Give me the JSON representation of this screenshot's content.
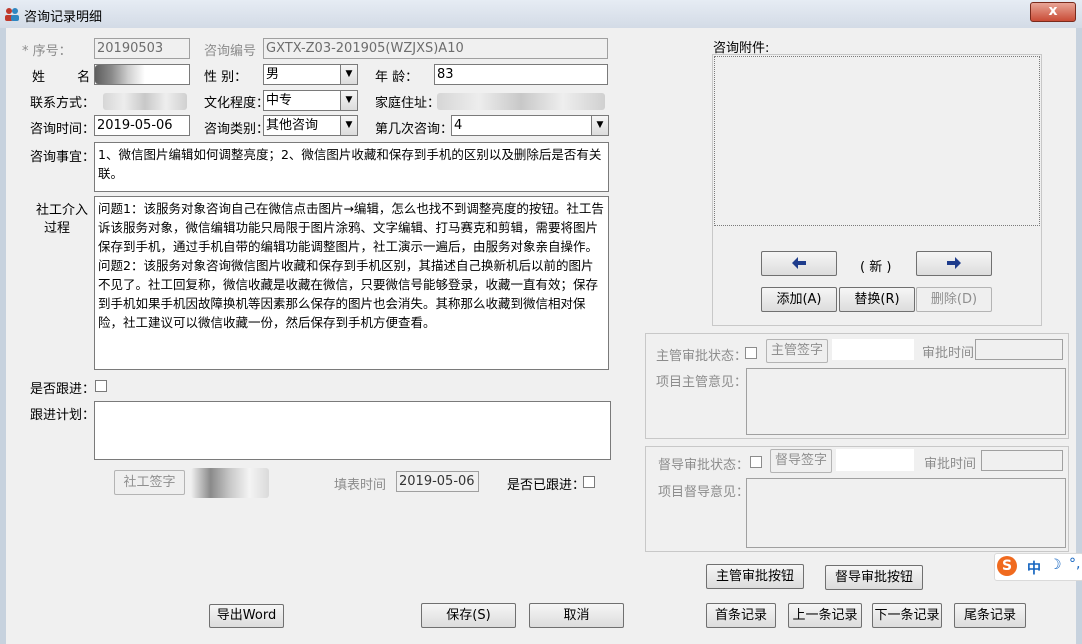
{
  "window": {
    "title": "咨询记录明细",
    "close_label": "x"
  },
  "fields": {
    "seq_label": "* 序号：",
    "seq_value": "20190503",
    "consult_no_label": "咨询编号",
    "consult_no_value": "GXTX-Z03-201905(WZJXS)A10",
    "name_label": "姓 名",
    "gender_label": "性 别：",
    "gender_value": "男",
    "age_label": "年 龄：",
    "age_value": "83",
    "contact_label": "联系方式：",
    "education_label": "文化程度：",
    "education_value": "中专",
    "address_label": "家庭住址：",
    "consult_time_label": "咨询时间：",
    "consult_time_value": "2019-05-06",
    "consult_type_label": "咨询类别：",
    "consult_type_value": "其他咨询",
    "nth_label": "第几次咨询：",
    "nth_value": "4",
    "matter_label": "咨询事宜：",
    "matter_value": "1、微信图片编辑如何调整亮度；2、微信图片收藏和保存到手机的区别以及删除后是否有关联。",
    "process_label_1": "社工介入",
    "process_label_2": "过程",
    "process_value": "问题1：该服务对象咨询自己在微信点击图片→编辑，怎么也找不到调整亮度的按钮。社工告诉该服务对象，微信编辑功能只局限于图片涂鸦、文字编辑、打马赛克和剪辑，需要将图片保存到手机，通过手机自带的编辑功能调整图片，社工演示一遍后，由服务对象亲自操作。\n问题2：该服务对象咨询微信图片收藏和保存到手机区别，其描述自己换新机后以前的图片不见了。社工回复称，微信收藏是收藏在微信，只要微信号能够登录，收藏一直有效；保存到手机如果手机因故障换机等因素那么保存的图片也会消失。其称那么收藏到微信相对保险，社工建议可以微信收藏一份，然后保存到手机方便查看。",
    "followup_label": "是否跟进：",
    "plan_label": "跟进计划：",
    "worker_sign_button": "社工签字",
    "fill_time_label": "填表时间",
    "fill_time_value": "2019-05-06",
    "followed_label": "是否已跟进："
  },
  "attachment": {
    "label": "咨询附件:",
    "prev_icon": "arrow-left",
    "next_icon": "arrow-right",
    "status": "( 新 )",
    "add_button": "添加(A)",
    "replace_button": "替换(R)",
    "delete_button": "删除(D)"
  },
  "supervisor": {
    "status_label": "主管审批状态：",
    "sign_button": "主管签字",
    "time_label": "审批时间",
    "opinion_label": "项目主管意见："
  },
  "inspector": {
    "status_label": "督导审批状态：",
    "sign_button": "督导签字",
    "time_label": "审批时间",
    "opinion_label": "项目督导意见："
  },
  "approval": {
    "supervisor_button": "主管审批按钮",
    "inspector_button": "督导审批按钮"
  },
  "bottom": {
    "export_button": "导出Word",
    "save_button": "保存(S)",
    "cancel_button": "取消",
    "first_button": "首条记录",
    "prev_button": "上一条记录",
    "next_button": "下一条记录",
    "last_button": "尾条记录"
  },
  "ime": {
    "label": "中"
  },
  "colors": {
    "titlebar": "#d3dbe6",
    "close": "#c94c36",
    "window": "#f0f0f0",
    "arrow": "#1e3c8c"
  }
}
